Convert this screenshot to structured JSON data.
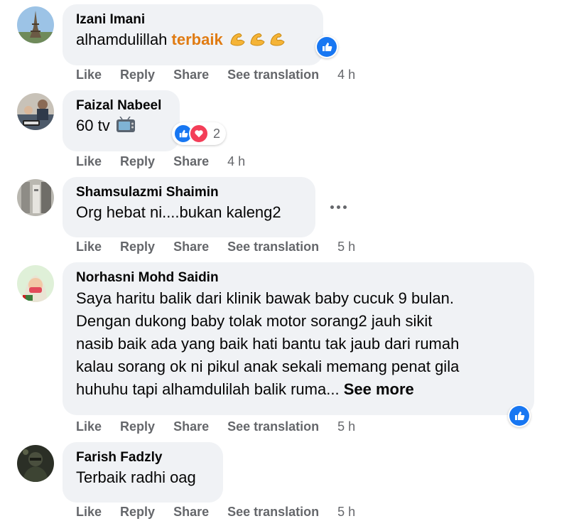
{
  "actions": {
    "like": "Like",
    "reply": "Reply",
    "share": "Share",
    "see_translation": "See translation"
  },
  "colors": {
    "bubble_bg": "#f0f2f5",
    "meta_text": "#65676b",
    "like_blue": "#1877f2",
    "love_red": "#f33e58",
    "accent_orange": "#e07b12"
  },
  "comments": [
    {
      "author": "Izani Imani",
      "text": "alhamdulillah ",
      "highlight": "terbaik",
      "emoji": "flexed-biceps x3",
      "time": "4 h",
      "reactions": [
        "like"
      ]
    },
    {
      "author": "Faizal Nabeel",
      "text": "60 tv",
      "emoji": "television",
      "time": "4 h",
      "reactions": [
        "like",
        "love"
      ],
      "reaction_count": "2"
    },
    {
      "author": "Shamsulazmi Shaimin",
      "text": "Org hebat ni....bukan kaleng2",
      "time": "5 h"
    },
    {
      "author": "Norhasni Mohd Saidin",
      "lines": [
        "Saya haritu balik dari klinik bawak baby cucuk 9 bulan.",
        "Dengan dukong baby tolak motor sorang2 jauh sikit",
        "nasib baik ada yang baik hati bantu tak jaub dari rumah",
        "kalau sorang ok ni pikul anak sekali memang penat gila",
        "huhuhu tapi alhamdulilah balik ruma..."
      ],
      "see_more": "See more",
      "time": "5 h",
      "reactions": [
        "like"
      ]
    },
    {
      "author": "Farish Fadzly",
      "text": "Terbaik radhi oag",
      "time": "5 h"
    }
  ]
}
